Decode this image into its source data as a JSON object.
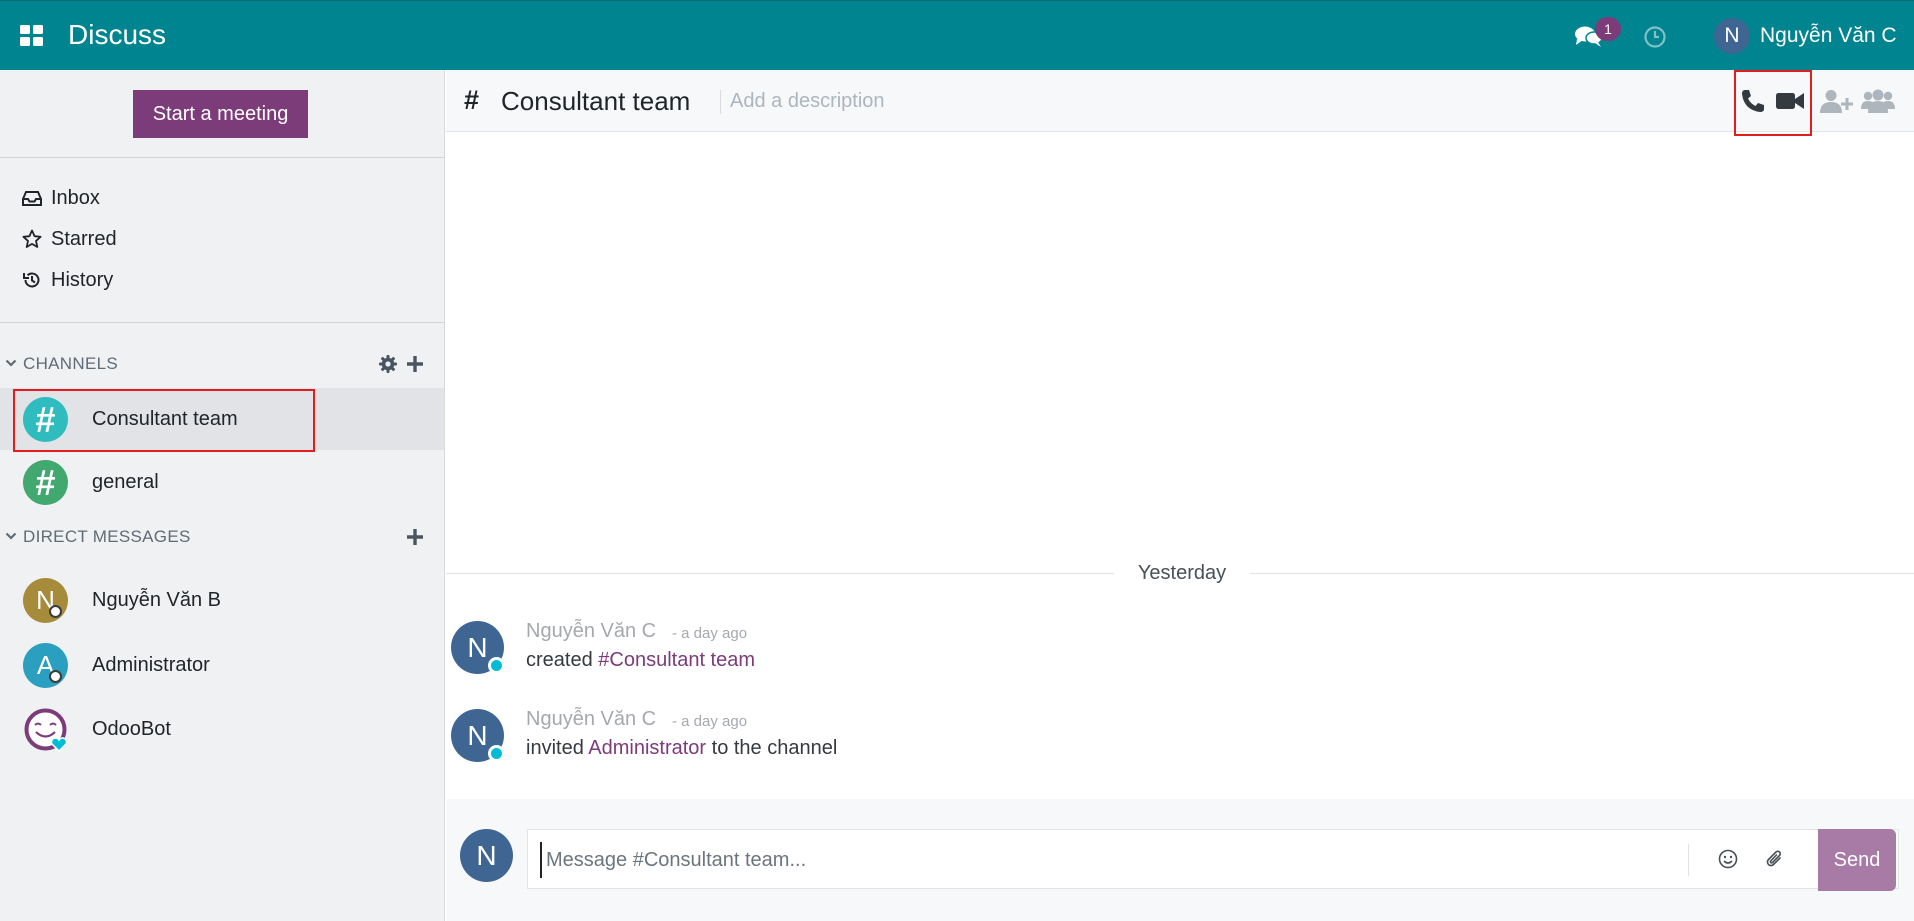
{
  "app": {
    "title": "Discuss"
  },
  "topbar": {
    "notification_count": "1",
    "user_initial": "N",
    "user_name": "Nguyễn Văn C"
  },
  "sidebar": {
    "start_meeting_label": "Start a meeting",
    "nav": [
      {
        "label": "Inbox",
        "icon": "inbox-icon"
      },
      {
        "label": "Starred",
        "icon": "star-icon"
      },
      {
        "label": "History",
        "icon": "history-icon"
      }
    ],
    "channels_header": "CHANNELS",
    "channels": [
      {
        "label": "Consultant team",
        "icon_glyph": "#",
        "color": "#2ebcbf",
        "active": true
      },
      {
        "label": "general",
        "icon_glyph": "#",
        "color": "#41a86f",
        "active": false
      }
    ],
    "dm_header": "DIRECT MESSAGES",
    "direct_messages": [
      {
        "label": "Nguyễn Văn B",
        "initial": "N",
        "color": "#a68c3a"
      },
      {
        "label": "Administrator",
        "initial": "A",
        "color": "#2b9fbf"
      },
      {
        "label": "OdooBot",
        "initial": "",
        "color": "#7c3b79"
      }
    ]
  },
  "thread": {
    "hash": "#",
    "name": "Consultant team",
    "description_placeholder": "Add a description",
    "date_separator": "Yesterday",
    "messages": [
      {
        "initial": "N",
        "author": "Nguyễn Văn C",
        "date": "- a day ago",
        "prefix": "created ",
        "link": "#Consultant team",
        "suffix": ""
      },
      {
        "initial": "N",
        "author": "Nguyễn Văn C",
        "date": "- a day ago",
        "prefix": "invited ",
        "link": "Administrator",
        "suffix": " to the channel"
      }
    ]
  },
  "composer": {
    "initial": "N",
    "placeholder": "Message #Consultant team...",
    "send_label": "Send"
  },
  "colors": {
    "topbar": "#00848f",
    "brand_purple": "#7c3b79",
    "highlight": "#e11d1d"
  }
}
